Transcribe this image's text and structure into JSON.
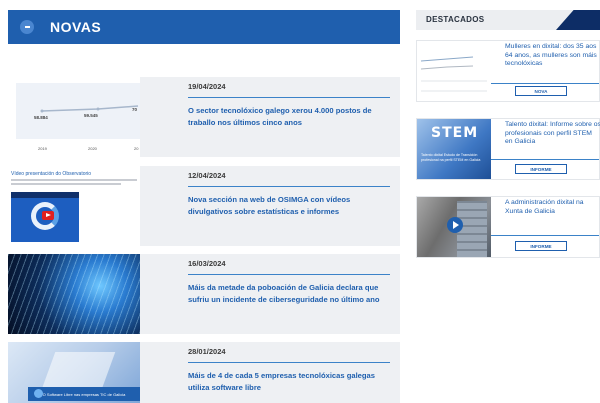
{
  "novas": {
    "title": "NOVAS",
    "items": [
      {
        "date": "19/04/2024",
        "title": "O sector tecnolóxico galego xerou 4.000 postos de traballo nos últimos cinco anos",
        "thumb": {
          "chart_labels": [
            "58.884",
            "59.545",
            "70"
          ],
          "years": [
            "2019",
            "2020",
            "20"
          ]
        }
      },
      {
        "date": "12/04/2024",
        "title": "Nova sección na web de OSIMGA con vídeos divulgativos sobre estatísticas e informes",
        "thumb": {
          "caption": "Vídeo presentación do Observatorio"
        }
      },
      {
        "date": "16/03/2024",
        "title": "Máis da metade da poboación de Galicia declara que sufriu un incidente de ciberseguridade no último ano"
      },
      {
        "date": "28/01/2024",
        "title": "Máis de 4 de cada 5 empresas tecnolóxicas galegas utiliza software libre",
        "thumb": {
          "caption": "O Software Libre nas empresas TIC de Galicia"
        }
      }
    ]
  },
  "destacados": {
    "title": "DESTACADOS",
    "items": [
      {
        "text": "Mulleres en dixital: dos 35 aos 64 anos, as mulleres son máis tecnolóxicas",
        "button": "NOVA"
      },
      {
        "text": "Talento dixital: Informe sobre os profesionais con perfil STEM en Galicia",
        "button": "INFORME",
        "thumb": {
          "big": "STEM",
          "caption": "Talento dixital Estudo de Transición profesional na perfil STEM en Galicia"
        }
      },
      {
        "text": "A administración dixital na Xunta de Galicia",
        "button": "INFORME"
      }
    ]
  },
  "colors": {
    "brand_blue": "#1f5fae",
    "dark_navy": "#0d2d66",
    "card_bg": "#eef0f3"
  }
}
